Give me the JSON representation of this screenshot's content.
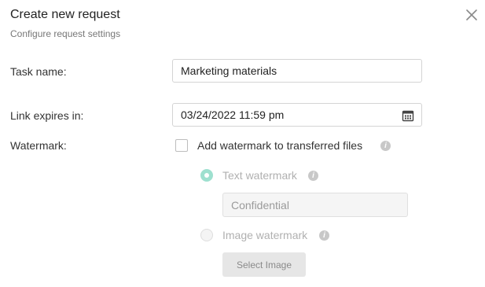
{
  "dialog": {
    "title": "Create new request",
    "subtitle": "Configure request settings",
    "close_icon": "close-icon"
  },
  "task": {
    "label": "Task name:",
    "value": "Marketing materials"
  },
  "expires": {
    "label": "Link expires in:",
    "value": "03/24/2022 11:59 pm",
    "icon": "calendar-icon"
  },
  "watermark": {
    "label": "Watermark:",
    "checkbox_label": "Add watermark to transferred files",
    "checked": false,
    "text_option": {
      "label": "Text watermark",
      "selected": true,
      "value": "Confidential"
    },
    "image_option": {
      "label": "Image watermark",
      "selected": false,
      "button_label": "Select Image"
    }
  },
  "colors": {
    "radio_selected": "#9ee0cf",
    "disabled_text": "#b0b0b0",
    "info_icon": "#c8c8c8"
  }
}
